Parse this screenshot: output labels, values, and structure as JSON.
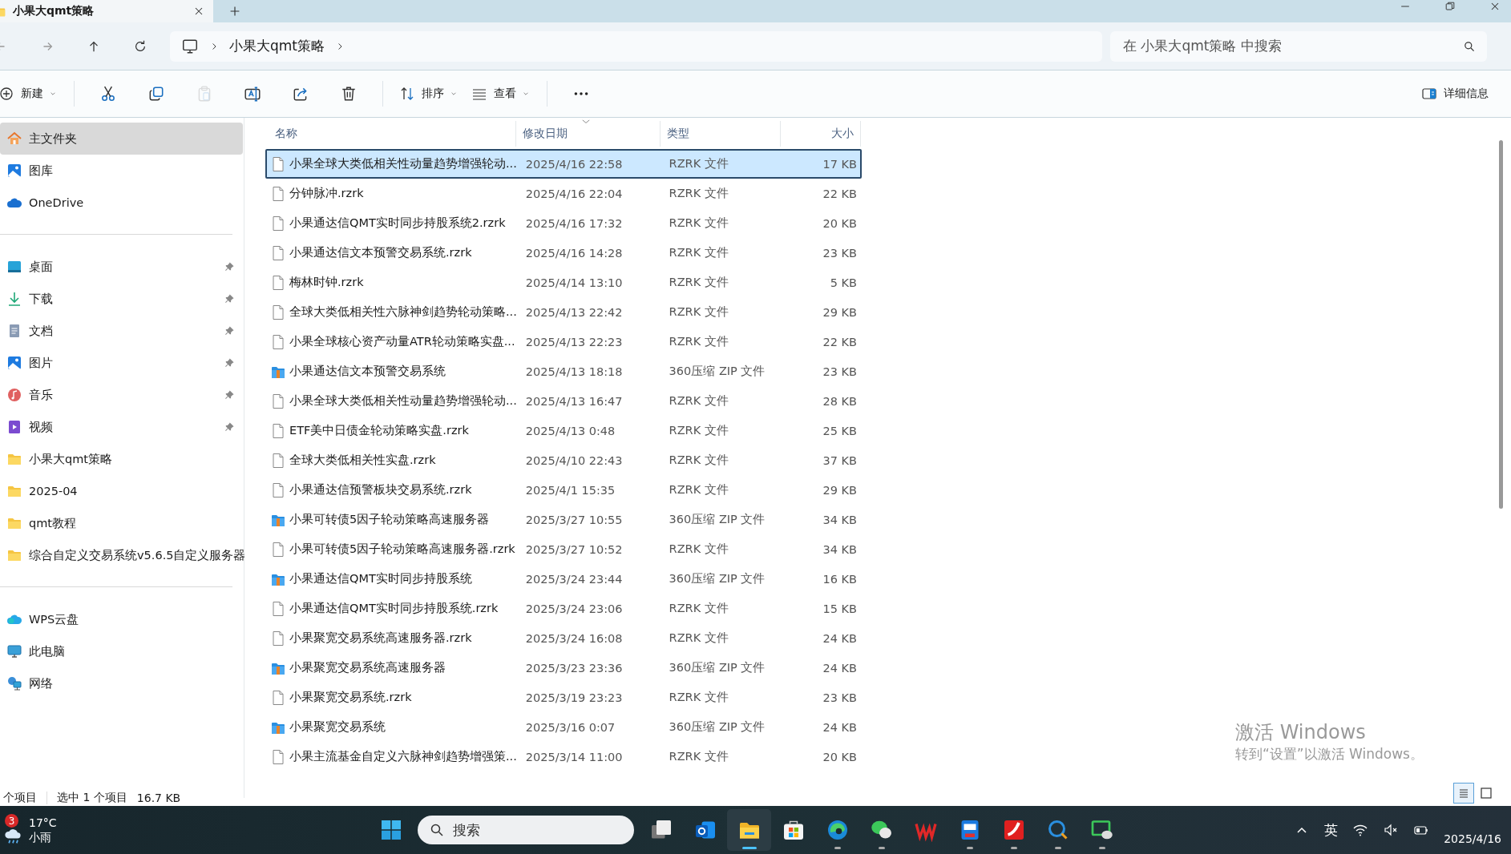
{
  "tab": {
    "title": "小果大qmt策略",
    "selected": true
  },
  "address": {
    "crumbs": [
      "小果大qmt策略"
    ],
    "search": {
      "placeholder": "在 小果大qmt策略 中搜索"
    }
  },
  "toolbar": {
    "items": [
      {
        "kind": "button",
        "label": "新建"
      },
      {
        "kind": "divider"
      },
      {
        "kind": "icon",
        "disabled": false
      },
      {
        "kind": "icon",
        "disabled": false
      },
      {
        "kind": "icon",
        "disabled": true
      },
      {
        "kind": "icon",
        "disabled": false
      },
      {
        "kind": "icon",
        "disabled": false
      },
      {
        "kind": "icon",
        "disabled": false
      },
      {
        "kind": "divider"
      },
      {
        "kind": "button",
        "label": "排序"
      },
      {
        "kind": "button",
        "label": "查看"
      },
      {
        "kind": "divider"
      },
      {
        "kind": "icon",
        "disabled": false
      }
    ],
    "details": {
      "label": "详细信息"
    }
  },
  "sidebar": {
    "groups": [
      [
        {
          "label": "主文件夹",
          "pinned": false,
          "selected": true
        },
        {
          "label": "图库",
          "pinned": false,
          "selected": false
        },
        {
          "label": "OneDrive",
          "pinned": false,
          "selected": false
        }
      ],
      [
        {
          "label": "桌面",
          "pinned": true,
          "selected": false
        },
        {
          "label": "下载",
          "pinned": true,
          "selected": false
        },
        {
          "label": "文档",
          "pinned": true,
          "selected": false
        },
        {
          "label": "图片",
          "pinned": true,
          "selected": false
        },
        {
          "label": "音乐",
          "pinned": true,
          "selected": false
        },
        {
          "label": "视频",
          "pinned": true,
          "selected": false
        },
        {
          "label": "小果大qmt策略",
          "pinned": false,
          "selected": false
        },
        {
          "label": "2025-04",
          "pinned": false,
          "selected": false
        },
        {
          "label": "qmt教程",
          "pinned": false,
          "selected": false
        },
        {
          "label": "综合自定义交易系统v5.6.5自定义服务器",
          "pinned": false,
          "selected": false
        }
      ],
      [
        {
          "label": "WPS云盘",
          "pinned": false,
          "selected": false
        },
        {
          "label": "此电脑",
          "pinned": false,
          "selected": false
        },
        {
          "label": "网络",
          "pinned": false,
          "selected": false
        }
      ]
    ]
  },
  "table": {
    "columns": [
      {
        "label": "名称",
        "sorted": false
      },
      {
        "label": "修改日期",
        "sorted": true
      },
      {
        "label": "类型",
        "sorted": false
      },
      {
        "label": "大小",
        "sorted": false
      }
    ],
    "rows": [
      {
        "kind": "file",
        "name": "小果全球大类低相关性动量趋势增强轮动...",
        "date": "2025/4/16 22:58",
        "type": "RZRK 文件",
        "size": "17 KB",
        "selected": true
      },
      {
        "kind": "file",
        "name": "分钟脉冲.rzrk",
        "date": "2025/4/16 22:04",
        "type": "RZRK 文件",
        "size": "22 KB",
        "selected": false
      },
      {
        "kind": "file",
        "name": "小果通达信QMT实时同步持股系统2.rzrk",
        "date": "2025/4/16 17:32",
        "type": "RZRK 文件",
        "size": "20 KB",
        "selected": false
      },
      {
        "kind": "file",
        "name": "小果通达信文本预警交易系统.rzrk",
        "date": "2025/4/16 14:28",
        "type": "RZRK 文件",
        "size": "23 KB",
        "selected": false
      },
      {
        "kind": "file",
        "name": "梅林时钟.rzrk",
        "date": "2025/4/14 13:10",
        "type": "RZRK 文件",
        "size": "5 KB",
        "selected": false
      },
      {
        "kind": "file",
        "name": "全球大类低相关性六脉神剑趋势轮动策略...",
        "date": "2025/4/13 22:42",
        "type": "RZRK 文件",
        "size": "29 KB",
        "selected": false
      },
      {
        "kind": "file",
        "name": "小果全球核心资产动量ATR轮动策略实盘...",
        "date": "2025/4/13 22:23",
        "type": "RZRK 文件",
        "size": "22 KB",
        "selected": false
      },
      {
        "kind": "zip",
        "name": "小果通达信文本预警交易系统",
        "date": "2025/4/13 18:18",
        "type": "360压缩 ZIP 文件",
        "size": "23 KB",
        "selected": false
      },
      {
        "kind": "file",
        "name": "小果全球大类低相关性动量趋势增强轮动...",
        "date": "2025/4/13 16:47",
        "type": "RZRK 文件",
        "size": "28 KB",
        "selected": false
      },
      {
        "kind": "file",
        "name": "ETF美中日债金轮动策略实盘.rzrk",
        "date": "2025/4/13 0:48",
        "type": "RZRK 文件",
        "size": "25 KB",
        "selected": false
      },
      {
        "kind": "file",
        "name": "全球大类低相关性实盘.rzrk",
        "date": "2025/4/10 22:43",
        "type": "RZRK 文件",
        "size": "37 KB",
        "selected": false
      },
      {
        "kind": "file",
        "name": "小果通达信预警板块交易系统.rzrk",
        "date": "2025/4/1 15:35",
        "type": "RZRK 文件",
        "size": "29 KB",
        "selected": false
      },
      {
        "kind": "zip",
        "name": "小果可转债5因子轮动策略高速服务器",
        "date": "2025/3/27 10:55",
        "type": "360压缩 ZIP 文件",
        "size": "34 KB",
        "selected": false
      },
      {
        "kind": "file",
        "name": "小果可转债5因子轮动策略高速服务器.rzrk",
        "date": "2025/3/27 10:52",
        "type": "RZRK 文件",
        "size": "34 KB",
        "selected": false
      },
      {
        "kind": "zip",
        "name": "小果通达信QMT实时同步持股系统",
        "date": "2025/3/24 23:44",
        "type": "360压缩 ZIP 文件",
        "size": "16 KB",
        "selected": false
      },
      {
        "kind": "file",
        "name": "小果通达信QMT实时同步持股系统.rzrk",
        "date": "2025/3/24 23:06",
        "type": "RZRK 文件",
        "size": "15 KB",
        "selected": false
      },
      {
        "kind": "file",
        "name": "小果聚宽交易系统高速服务器.rzrk",
        "date": "2025/3/24 16:08",
        "type": "RZRK 文件",
        "size": "24 KB",
        "selected": false
      },
      {
        "kind": "zip",
        "name": "小果聚宽交易系统高速服务器",
        "date": "2025/3/23 23:36",
        "type": "360压缩 ZIP 文件",
        "size": "24 KB",
        "selected": false
      },
      {
        "kind": "file",
        "name": "小果聚宽交易系统.rzrk",
        "date": "2025/3/19 23:23",
        "type": "RZRK 文件",
        "size": "23 KB",
        "selected": false
      },
      {
        "kind": "zip",
        "name": "小果聚宽交易系统",
        "date": "2025/3/16 0:07",
        "type": "360压缩 ZIP 文件",
        "size": "24 KB",
        "selected": false
      },
      {
        "kind": "file",
        "name": "小果主流基金自定义六脉神剑趋势增强策...",
        "date": "2025/3/14 11:00",
        "type": "RZRK 文件",
        "size": "20 KB",
        "selected": false
      }
    ]
  },
  "status_bar": {
    "count": "个项目",
    "selection": "选中 1 个项目",
    "size": "16.7 KB"
  },
  "view_toggle": [
    {
      "kind": "details",
      "selected": true
    },
    {
      "kind": "tiles",
      "selected": false
    }
  ],
  "activation": {
    "title": "激活 Windows",
    "subtitle": "转到“设置”以激活 Windows。"
  },
  "taskbar": {
    "weather": {
      "badge": "3",
      "temp": "17°C",
      "condition": "小雨"
    },
    "search": {
      "placeholder": "搜索"
    },
    "apps": [
      {
        "active": false,
        "running": false
      },
      {
        "active": false,
        "running": false
      },
      {
        "active": false,
        "running": false
      },
      {
        "active": true,
        "running": true
      },
      {
        "active": false,
        "running": false
      },
      {
        "active": false,
        "running": true
      },
      {
        "active": false,
        "running": true
      },
      {
        "active": false,
        "running": false
      },
      {
        "active": false,
        "running": true
      },
      {
        "active": false,
        "running": true
      },
      {
        "active": false,
        "running": true
      },
      {
        "active": false,
        "running": true
      }
    ],
    "tray": {
      "input": "英",
      "date": "2025/4/16"
    }
  }
}
